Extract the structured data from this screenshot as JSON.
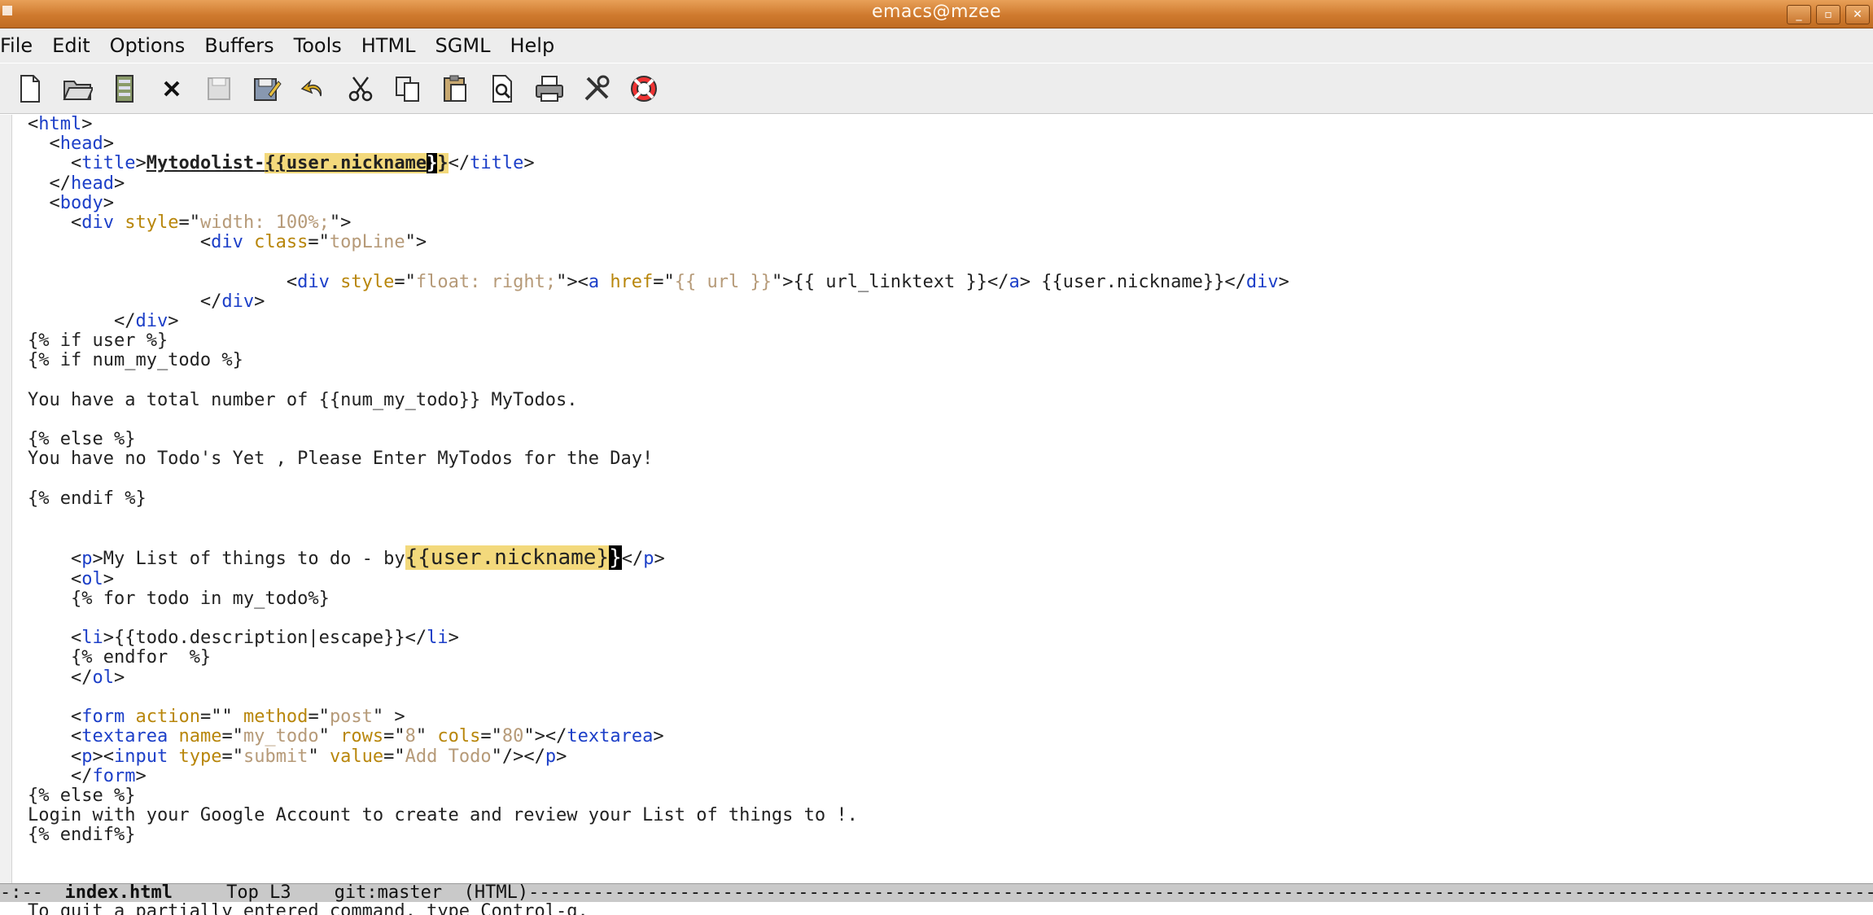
{
  "window": {
    "title": "emacs@mzee"
  },
  "menu": [
    "File",
    "Edit",
    "Options",
    "Buffers",
    "Tools",
    "HTML",
    "SGML",
    "Help"
  ],
  "toolbar": [
    "new-file-icon",
    "open-folder-icon",
    "open-directory-icon",
    "close-icon",
    "save-icon",
    "save-as-icon",
    "undo-icon",
    "cut-icon",
    "copy-icon",
    "paste-icon",
    "search-icon",
    "print-icon",
    "preferences-icon",
    "help-icon"
  ],
  "code_lines": [
    "<html>",
    "  <head>",
    "    <title>Mytodolist-{{user.nickname}}</title>",
    "  </head>",
    "  <body>",
    "    <div style=\"width: 100%;\">",
    "                <div class=\"topLine\">",
    "",
    "                        <div style=\"float: right;\"><a href=\"{{ url }}\">{{ url_linktext }}</a> {{user.nickname}}</div>",
    "                </div>",
    "        </div>",
    "{% if user %}",
    "{% if num_my_todo %}",
    "",
    "You have a total number of {{num_my_todo}} MyTodos.",
    "",
    "{% else %}",
    "You have no Todo's Yet , Please Enter MyTodos for the Day!",
    "",
    "{% endif %}",
    "",
    "",
    "    <p>My List of things to do - by{{user.nickname}}</p>",
    "    <ol>",
    "    {% for todo in my_todo%}",
    "",
    "    <li>{{todo.description|escape}}</li>",
    "    {% endfor  %}",
    "    </ol>",
    "",
    "    <form action=\"\" method=\"post\" >",
    "    <textarea name=\"my_todo\" rows=\"8\" cols=\"80\"></textarea>",
    "    <p><input type=\"submit\" value=\"Add Todo\"/></p>",
    "    </form>",
    "{% else %}",
    "Login with your Google Account to create and review your List of things to !.",
    "{% endif%}"
  ],
  "modeline": {
    "prefix": "-:--  ",
    "buffer": "index.html",
    "position": "Top L3",
    "vc": "git:master",
    "mode": "(HTML)"
  },
  "echo": "To quit a partially entered command, type Control-g."
}
